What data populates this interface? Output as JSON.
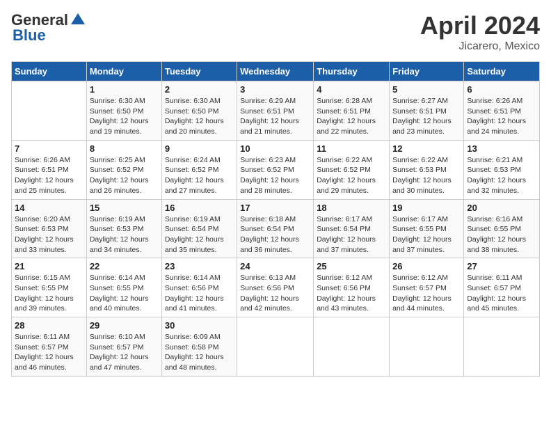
{
  "header": {
    "logo_general": "General",
    "logo_blue": "Blue",
    "title": "April 2024",
    "subtitle": "Jicarero, Mexico"
  },
  "weekdays": [
    "Sunday",
    "Monday",
    "Tuesday",
    "Wednesday",
    "Thursday",
    "Friday",
    "Saturday"
  ],
  "weeks": [
    [
      {
        "day": "",
        "sunrise": "",
        "sunset": "",
        "daylight": ""
      },
      {
        "day": "1",
        "sunrise": "Sunrise: 6:30 AM",
        "sunset": "Sunset: 6:50 PM",
        "daylight": "Daylight: 12 hours and 19 minutes."
      },
      {
        "day": "2",
        "sunrise": "Sunrise: 6:30 AM",
        "sunset": "Sunset: 6:50 PM",
        "daylight": "Daylight: 12 hours and 20 minutes."
      },
      {
        "day": "3",
        "sunrise": "Sunrise: 6:29 AM",
        "sunset": "Sunset: 6:51 PM",
        "daylight": "Daylight: 12 hours and 21 minutes."
      },
      {
        "day": "4",
        "sunrise": "Sunrise: 6:28 AM",
        "sunset": "Sunset: 6:51 PM",
        "daylight": "Daylight: 12 hours and 22 minutes."
      },
      {
        "day": "5",
        "sunrise": "Sunrise: 6:27 AM",
        "sunset": "Sunset: 6:51 PM",
        "daylight": "Daylight: 12 hours and 23 minutes."
      },
      {
        "day": "6",
        "sunrise": "Sunrise: 6:26 AM",
        "sunset": "Sunset: 6:51 PM",
        "daylight": "Daylight: 12 hours and 24 minutes."
      }
    ],
    [
      {
        "day": "7",
        "sunrise": "Sunrise: 6:26 AM",
        "sunset": "Sunset: 6:51 PM",
        "daylight": "Daylight: 12 hours and 25 minutes."
      },
      {
        "day": "8",
        "sunrise": "Sunrise: 6:25 AM",
        "sunset": "Sunset: 6:52 PM",
        "daylight": "Daylight: 12 hours and 26 minutes."
      },
      {
        "day": "9",
        "sunrise": "Sunrise: 6:24 AM",
        "sunset": "Sunset: 6:52 PM",
        "daylight": "Daylight: 12 hours and 27 minutes."
      },
      {
        "day": "10",
        "sunrise": "Sunrise: 6:23 AM",
        "sunset": "Sunset: 6:52 PM",
        "daylight": "Daylight: 12 hours and 28 minutes."
      },
      {
        "day": "11",
        "sunrise": "Sunrise: 6:22 AM",
        "sunset": "Sunset: 6:52 PM",
        "daylight": "Daylight: 12 hours and 29 minutes."
      },
      {
        "day": "12",
        "sunrise": "Sunrise: 6:22 AM",
        "sunset": "Sunset: 6:53 PM",
        "daylight": "Daylight: 12 hours and 30 minutes."
      },
      {
        "day": "13",
        "sunrise": "Sunrise: 6:21 AM",
        "sunset": "Sunset: 6:53 PM",
        "daylight": "Daylight: 12 hours and 32 minutes."
      }
    ],
    [
      {
        "day": "14",
        "sunrise": "Sunrise: 6:20 AM",
        "sunset": "Sunset: 6:53 PM",
        "daylight": "Daylight: 12 hours and 33 minutes."
      },
      {
        "day": "15",
        "sunrise": "Sunrise: 6:19 AM",
        "sunset": "Sunset: 6:53 PM",
        "daylight": "Daylight: 12 hours and 34 minutes."
      },
      {
        "day": "16",
        "sunrise": "Sunrise: 6:19 AM",
        "sunset": "Sunset: 6:54 PM",
        "daylight": "Daylight: 12 hours and 35 minutes."
      },
      {
        "day": "17",
        "sunrise": "Sunrise: 6:18 AM",
        "sunset": "Sunset: 6:54 PM",
        "daylight": "Daylight: 12 hours and 36 minutes."
      },
      {
        "day": "18",
        "sunrise": "Sunrise: 6:17 AM",
        "sunset": "Sunset: 6:54 PM",
        "daylight": "Daylight: 12 hours and 37 minutes."
      },
      {
        "day": "19",
        "sunrise": "Sunrise: 6:17 AM",
        "sunset": "Sunset: 6:55 PM",
        "daylight": "Daylight: 12 hours and 37 minutes."
      },
      {
        "day": "20",
        "sunrise": "Sunrise: 6:16 AM",
        "sunset": "Sunset: 6:55 PM",
        "daylight": "Daylight: 12 hours and 38 minutes."
      }
    ],
    [
      {
        "day": "21",
        "sunrise": "Sunrise: 6:15 AM",
        "sunset": "Sunset: 6:55 PM",
        "daylight": "Daylight: 12 hours and 39 minutes."
      },
      {
        "day": "22",
        "sunrise": "Sunrise: 6:14 AM",
        "sunset": "Sunset: 6:55 PM",
        "daylight": "Daylight: 12 hours and 40 minutes."
      },
      {
        "day": "23",
        "sunrise": "Sunrise: 6:14 AM",
        "sunset": "Sunset: 6:56 PM",
        "daylight": "Daylight: 12 hours and 41 minutes."
      },
      {
        "day": "24",
        "sunrise": "Sunrise: 6:13 AM",
        "sunset": "Sunset: 6:56 PM",
        "daylight": "Daylight: 12 hours and 42 minutes."
      },
      {
        "day": "25",
        "sunrise": "Sunrise: 6:12 AM",
        "sunset": "Sunset: 6:56 PM",
        "daylight": "Daylight: 12 hours and 43 minutes."
      },
      {
        "day": "26",
        "sunrise": "Sunrise: 6:12 AM",
        "sunset": "Sunset: 6:57 PM",
        "daylight": "Daylight: 12 hours and 44 minutes."
      },
      {
        "day": "27",
        "sunrise": "Sunrise: 6:11 AM",
        "sunset": "Sunset: 6:57 PM",
        "daylight": "Daylight: 12 hours and 45 minutes."
      }
    ],
    [
      {
        "day": "28",
        "sunrise": "Sunrise: 6:11 AM",
        "sunset": "Sunset: 6:57 PM",
        "daylight": "Daylight: 12 hours and 46 minutes."
      },
      {
        "day": "29",
        "sunrise": "Sunrise: 6:10 AM",
        "sunset": "Sunset: 6:57 PM",
        "daylight": "Daylight: 12 hours and 47 minutes."
      },
      {
        "day": "30",
        "sunrise": "Sunrise: 6:09 AM",
        "sunset": "Sunset: 6:58 PM",
        "daylight": "Daylight: 12 hours and 48 minutes."
      },
      {
        "day": "",
        "sunrise": "",
        "sunset": "",
        "daylight": ""
      },
      {
        "day": "",
        "sunrise": "",
        "sunset": "",
        "daylight": ""
      },
      {
        "day": "",
        "sunrise": "",
        "sunset": "",
        "daylight": ""
      },
      {
        "day": "",
        "sunrise": "",
        "sunset": "",
        "daylight": ""
      }
    ]
  ]
}
